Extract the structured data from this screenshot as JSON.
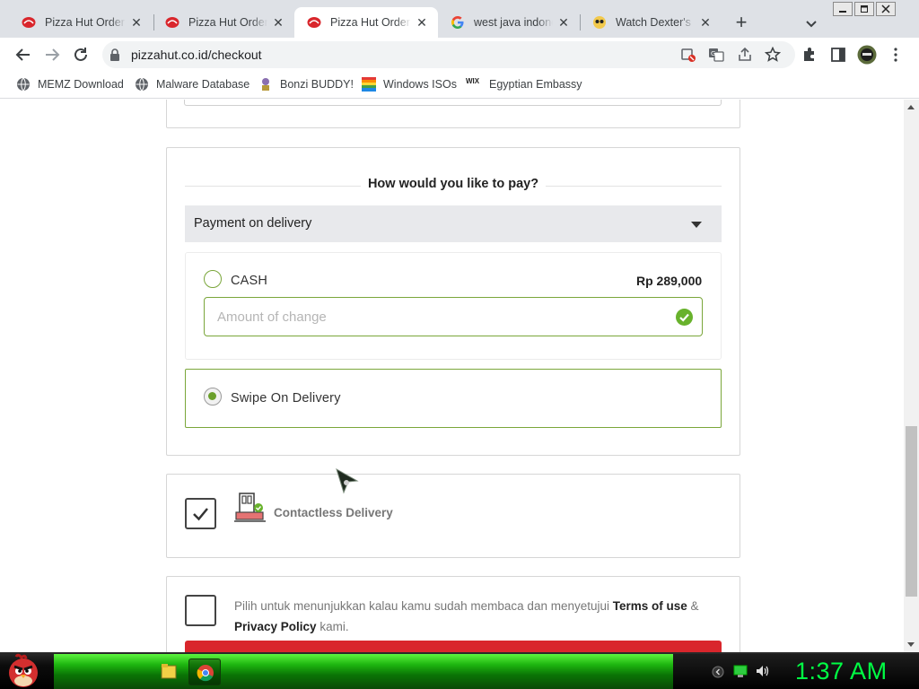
{
  "browser": {
    "tabs": [
      {
        "title": "Pizza Hut Order Me",
        "icon": "pizza-hut-icon",
        "active": false
      },
      {
        "title": "Pizza Hut Order Me",
        "icon": "pizza-hut-icon",
        "active": false
      },
      {
        "title": "Pizza Hut Order Me",
        "icon": "pizza-hut-icon",
        "active": true
      },
      {
        "title": "west java indonesi",
        "icon": "google-icon",
        "active": false
      },
      {
        "title": "Watch Dexter's Lab",
        "icon": "dexter-icon",
        "active": false
      }
    ],
    "close_glyph": "✕",
    "new_tab_glyph": "+",
    "url": "pizzahut.co.id/checkout",
    "bookmarks": [
      {
        "label": "MEMZ Download",
        "icon": "globe-icon"
      },
      {
        "label": "Malware Database",
        "icon": "globe-icon"
      },
      {
        "label": "Bonzi BUDDY!",
        "icon": "bonzi-icon"
      },
      {
        "label": "Windows ISOs",
        "icon": "rainbow-icon"
      },
      {
        "label": "Egyptian Embassy",
        "icon": "wix-icon"
      }
    ],
    "wix_text": "WIX"
  },
  "checkout": {
    "pay_heading": "How would you like to pay?",
    "payment_select": "Payment on delivery",
    "cash_label": "CASH",
    "cash_price": "Rp 289,000",
    "change_placeholder": "Amount of change",
    "swipe_label": "Swipe On Delivery",
    "contactless_label": "Contactless Delivery",
    "contactless_checked": true,
    "terms_prefix": "Pilih untuk menunjukkan kalau kamu sudah membaca dan menyetujui ",
    "terms_link": "Terms of use",
    "terms_amp": " & ",
    "privacy_link": "Privacy Policy",
    "terms_suffix": " kami."
  },
  "taskbar": {
    "clock": "1:37 AM"
  },
  "colors": {
    "accent_green": "#7aa63a",
    "pizza_red": "#d9262c",
    "clock_green": "#00ff44"
  }
}
